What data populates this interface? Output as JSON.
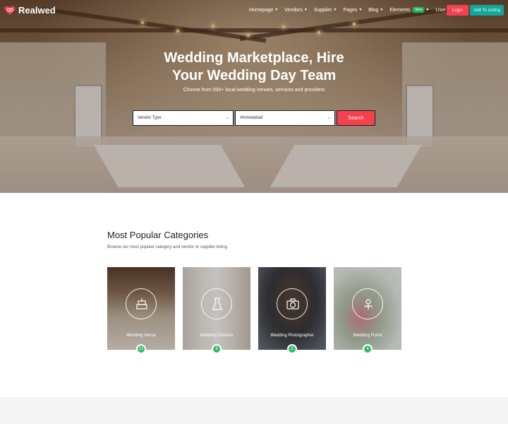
{
  "brand": {
    "name": "Realwed",
    "accent": "#f5404e",
    "teal": "#11a79a",
    "green": "#35b968"
  },
  "nav": {
    "items": [
      {
        "label": "Homepage"
      },
      {
        "label": "Vendors"
      },
      {
        "label": "Supplier"
      },
      {
        "label": "Pages"
      },
      {
        "label": "Blog"
      },
      {
        "label": "Elements",
        "badge": "New"
      },
      {
        "label": "User Panel"
      }
    ],
    "login_label": "Login",
    "listing_label": "Add To Listing"
  },
  "hero": {
    "title_line1": "Wedding Marketplace, Hire",
    "title_line2": "Your Wedding Day Team",
    "subtitle": "Choose from 500+ local wedding venues, services and providers",
    "vendor_select": "Vendor Type",
    "city_select": "Ahmedabad",
    "search_label": "Search"
  },
  "categories": {
    "title": "Most Popular Categories",
    "subtitle": "Browse our most popular category and vendor or supplier listing.",
    "items": [
      {
        "label": "Wedding Venue",
        "count": "12",
        "icon": "cake-icon"
      },
      {
        "label": "Wedding Dresses",
        "count": "6",
        "icon": "dress-icon"
      },
      {
        "label": "Wedding Photographer",
        "count": "2",
        "icon": "camera-icon"
      },
      {
        "label": "Wedding Florist",
        "count": "4",
        "icon": "flower-icon"
      }
    ]
  }
}
